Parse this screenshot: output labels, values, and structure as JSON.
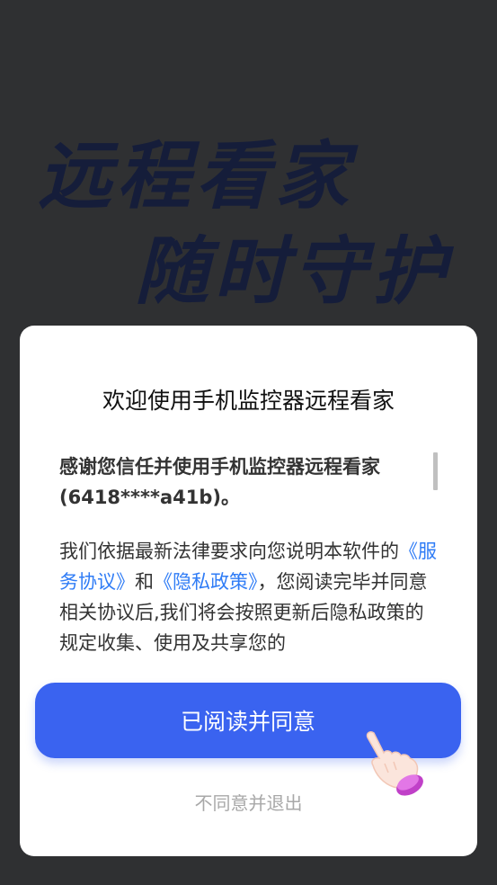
{
  "background": {
    "slogan_line1": "远程看家",
    "slogan_line2": "随时守护"
  },
  "dialog": {
    "title": "欢迎使用手机监控器远程看家",
    "intro": "感谢您信任并使用手机监控器远程看家(6418****a41b)。",
    "body_prefix": "我们依据最新法律要求向您说明本软件的",
    "service_link": "《服务协议》",
    "and": "和",
    "privacy_link": "《隐私政策》",
    "body_suffix": "，您阅读完毕并同意相关协议后,我们将会按照更新后隐私政策的规定收集、使用及共享您的",
    "agree_button": "已阅读并同意",
    "disagree_link": "不同意并退出"
  },
  "colors": {
    "accent": "#3a63f0",
    "link": "#2f7cf6",
    "slogan": "#151d3a"
  },
  "icons": {
    "hand": "pointing-hand-icon"
  }
}
